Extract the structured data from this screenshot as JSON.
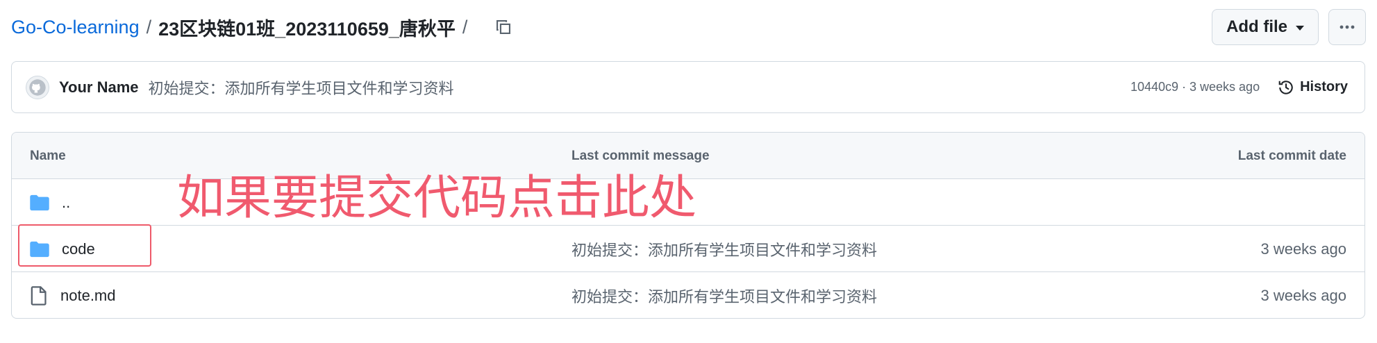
{
  "breadcrumb": {
    "repo": "Go-Co-learning",
    "separator": "/",
    "current": "23区块链01班_2023110659_唐秋平",
    "trailing_separator": "/"
  },
  "header_actions": {
    "add_file_label": "Add file",
    "more_label": "···"
  },
  "latest_commit": {
    "author": "Your Name",
    "message": "初始提交：添加所有学生项目文件和学习资料",
    "hash_and_age": "10440c9 · 3 weeks ago",
    "history_label": "History"
  },
  "file_table": {
    "columns": {
      "name": "Name",
      "message": "Last commit message",
      "date": "Last commit date"
    },
    "rows": [
      {
        "name": "..",
        "type": "folder",
        "message": "",
        "date": ""
      },
      {
        "name": "code",
        "type": "folder",
        "message": "初始提交：添加所有学生项目文件和学习资料",
        "date": "3 weeks ago"
      },
      {
        "name": "note.md",
        "type": "file",
        "message": "初始提交：添加所有学生项目文件和学习资料",
        "date": "3 weeks ago"
      }
    ]
  },
  "annotation": {
    "text": "如果要提交代码点击此处",
    "color": "#f05a6e"
  },
  "colors": {
    "link": "#0969da",
    "folder": "#54aeff",
    "border": "#d1d9e0",
    "muted": "#59636e"
  }
}
